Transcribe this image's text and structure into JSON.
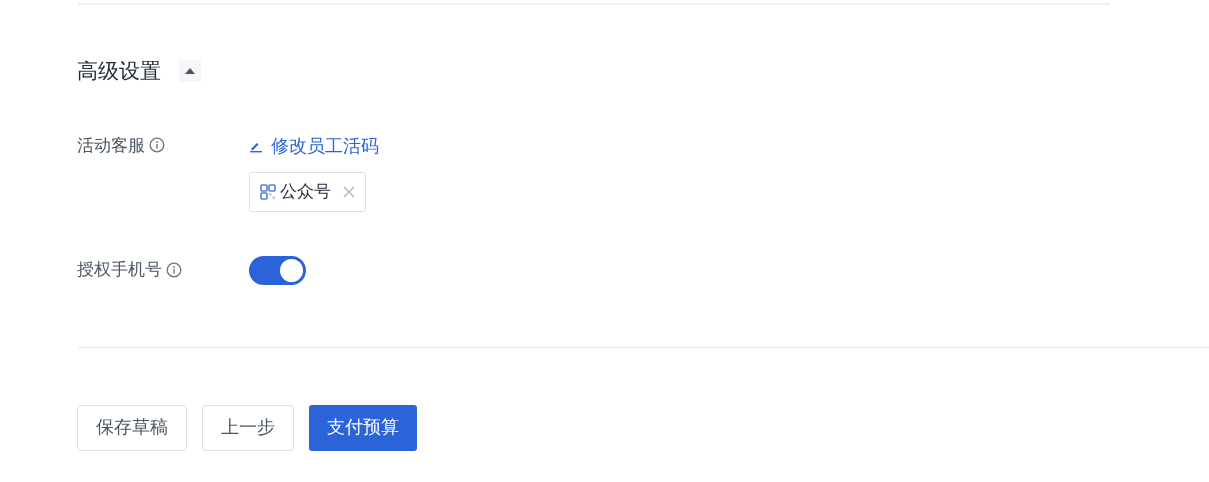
{
  "section": {
    "title": "高级设置",
    "expanded": true
  },
  "fields": [
    {
      "kind": "service",
      "label": "活动客服",
      "link": "修改员工活码",
      "tags": [
        "公众号"
      ]
    },
    {
      "kind": "switch",
      "label": "授权手机号",
      "on": true
    }
  ],
  "buttons": [
    {
      "label": "保存草稿",
      "primary": false
    },
    {
      "label": "上一步",
      "primary": false
    },
    {
      "label": "支付预算",
      "primary": true
    }
  ]
}
